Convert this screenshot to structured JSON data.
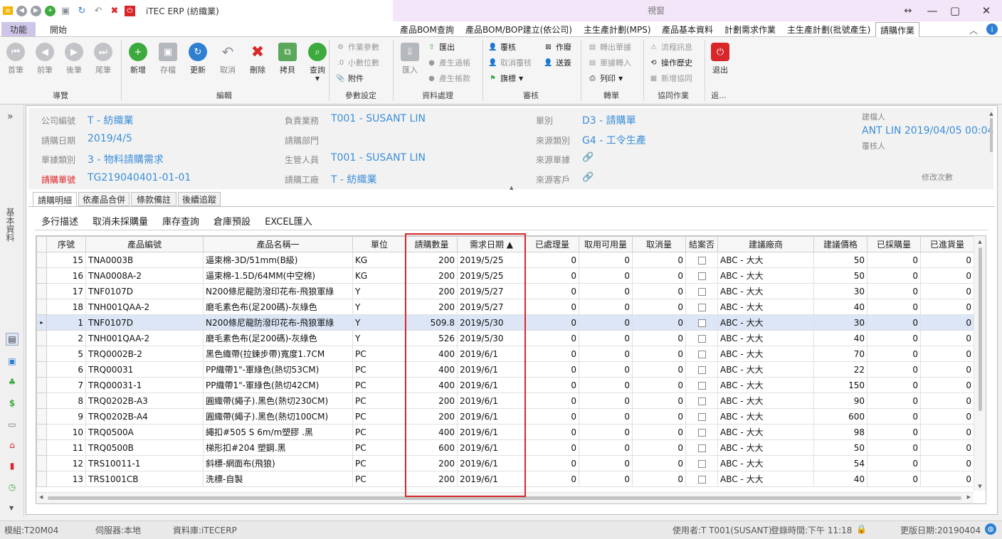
{
  "app": {
    "title": "iTEC ERP (紡織業)",
    "view_title": "視窗"
  },
  "menu": {
    "func_tab": "功能",
    "start_tab": "開始"
  },
  "ctx_tabs": [
    "產品BOM查詢",
    "產品BOM/BOP建立(依公司)",
    "主生產計劃(MPS)",
    "產品基本資料",
    "計劃需求作業",
    "主生產計劃(批號產生)",
    "請購作業"
  ],
  "ribbon": {
    "nav": {
      "first": "首筆",
      "prev": "前筆",
      "next": "後筆",
      "last": "尾筆",
      "group": "導覽"
    },
    "edit": {
      "add": "新增",
      "save": "存檔",
      "update": "更新",
      "cancel": "取消",
      "delete": "刪除",
      "copy": "拷貝",
      "query": "查詢",
      "group": "編輯"
    },
    "params": {
      "op_params": "作業參數",
      "decimals": "小數位數",
      "attach": "附件",
      "group": "參數設定"
    },
    "data": {
      "import": "匯入",
      "export": "匯出",
      "gen_transfer": "產生過帳",
      "gen_account": "產生帳款",
      "group": "資料處理"
    },
    "review": {
      "review": "覆核",
      "cancel_review": "取消覆核",
      "flag": "旗標",
      "void": "作廢",
      "send_sign": "送簽",
      "group": "審核"
    },
    "transfer": {
      "out_doc": "轉出單據",
      "doc_in": "單據轉入",
      "print": "列印",
      "group": "轉單"
    },
    "collab": {
      "flow_msg": "流程訊息",
      "op_history": "操作歷史",
      "add_collab": "新增協同",
      "group": "協同作業"
    },
    "exit": {
      "exit": "退出",
      "group": "返..."
    }
  },
  "left_label": "基本資料",
  "header": {
    "company_label": "公司編號",
    "company": "T - 紡織業",
    "date_label": "請購日期",
    "date": "2019/4/5",
    "doctype_label": "單據類別",
    "doctype": "3 - 物料請購需求",
    "docno_label": "請購單號",
    "docno": "TG219040401-01-01",
    "sales_label": "負責業務",
    "sales": "T001 - SUSANT LIN",
    "dept_label": "請購部門",
    "dept": "",
    "mgr_label": "生管人員",
    "mgr": "T001 - SUSANT LIN",
    "factory_label": "請購工廠",
    "factory": "T - 紡織業",
    "form_label": "單別",
    "form": "D3 - 請購單",
    "src_type_label": "來源類別",
    "src_type": "G4 - 工令生產",
    "src_doc_label": "來源單據",
    "src_cust_label": "來源客戶",
    "creator_label": "建檔人",
    "creator": "ANT LIN 2019/04/05 00:04",
    "reviewer_label": "覆核人",
    "modify_label": "修改次數"
  },
  "form_tabs": [
    "請購明細",
    "依產品合併",
    "條款備註",
    "後續追蹤"
  ],
  "grid_toolbar": [
    "多行描述",
    "取消未採購量",
    "庫存查詢",
    "倉庫預設",
    "EXCEL匯入"
  ],
  "grid": {
    "columns": [
      "序號",
      "產品編號",
      "產品名稱一",
      "單位",
      "請購數量",
      "需求日期 ▲",
      "已處理量",
      "取用可用量",
      "取消量",
      "結案否",
      "建議廠商",
      "建議價格",
      "已採購量",
      "已進貨量"
    ],
    "rows": [
      [
        "15",
        "TNA0003B",
        "逼束棉-3D/51mm(B級)",
        "KG",
        "200",
        "2019/5/25",
        "0",
        "0",
        "0",
        "",
        "ABC - 大大",
        "50",
        "0",
        "0"
      ],
      [
        "16",
        "TNA0008A-2",
        "逼束棉-1.5D/64MM(中空棉)",
        "KG",
        "200",
        "2019/5/25",
        "0",
        "0",
        "0",
        "",
        "ABC - 大大",
        "50",
        "0",
        "0"
      ],
      [
        "17",
        "TNF0107D",
        "N200條尼龍防潑印花布-飛狼軍綠",
        "Y",
        "200",
        "2019/5/27",
        "0",
        "0",
        "0",
        "",
        "ABC - 大大",
        "30",
        "0",
        "0"
      ],
      [
        "18",
        "TNH001QAA-2",
        "磨毛素色布(足200碼)-灰綠色",
        "Y",
        "200",
        "2019/5/27",
        "0",
        "0",
        "0",
        "",
        "ABC - 大大",
        "40",
        "0",
        "0"
      ],
      [
        "1",
        "TNF0107D",
        "N200條尼龍防潑印花布-飛狼軍綠",
        "Y",
        "509.8",
        "2019/5/30",
        "0",
        "0",
        "0",
        "",
        "ABC - 大大",
        "30",
        "0",
        "0"
      ],
      [
        "2",
        "TNH001QAA-2",
        "磨毛素色布(足200碼)-灰綠色",
        "Y",
        "526",
        "2019/5/30",
        "0",
        "0",
        "0",
        "",
        "ABC - 大大",
        "40",
        "0",
        "0"
      ],
      [
        "5",
        "TRQ0002B-2",
        "黑色織帶(拉鍊步帶)寬度1.7CM",
        "PC",
        "400",
        "2019/6/1",
        "0",
        "0",
        "0",
        "",
        "ABC - 大大",
        "70",
        "0",
        "0"
      ],
      [
        "6",
        "TRQ00031",
        "PP織帶1\"-軍綠色(熱切53CM)",
        "PC",
        "400",
        "2019/6/1",
        "0",
        "0",
        "0",
        "",
        "ABC - 大大",
        "22",
        "0",
        "0"
      ],
      [
        "7",
        "TRQ00031-1",
        "PP織帶1\"-軍綠色(熱切42CM)",
        "PC",
        "400",
        "2019/6/1",
        "0",
        "0",
        "0",
        "",
        "ABC - 大大",
        "150",
        "0",
        "0"
      ],
      [
        "8",
        "TRQ0202B-A3",
        "圓織帶(繩子).黑色(熱切230CM)",
        "PC",
        "200",
        "2019/6/1",
        "0",
        "0",
        "0",
        "",
        "ABC - 大大",
        "90",
        "0",
        "0"
      ],
      [
        "9",
        "TRQ0202B-A4",
        "圓織帶(繩子).黑色(熱切100CM)",
        "PC",
        "200",
        "2019/6/1",
        "0",
        "0",
        "0",
        "",
        "ABC - 大大",
        "600",
        "0",
        "0"
      ],
      [
        "10",
        "TRQ0500A",
        "繩扣#505 S 6m/m塑膠 .黑",
        "PC",
        "400",
        "2019/6/1",
        "0",
        "0",
        "0",
        "",
        "ABC - 大大",
        "98",
        "0",
        "0"
      ],
      [
        "11",
        "TRQ0500B",
        "梯形扣#204 塑鋼.黑",
        "PC",
        "600",
        "2019/6/1",
        "0",
        "0",
        "0",
        "",
        "ABC - 大大",
        "50",
        "0",
        "0"
      ],
      [
        "12",
        "TRS10011-1",
        "斜標-網面布(飛狼)",
        "PC",
        "200",
        "2019/6/1",
        "0",
        "0",
        "0",
        "",
        "ABC - 大大",
        "54",
        "0",
        "0"
      ],
      [
        "13",
        "TRS1001CB",
        "洗標-自製",
        "PC",
        "200",
        "2019/6/1",
        "0",
        "0",
        "0",
        "",
        "ABC - 大大",
        "40",
        "0",
        "0"
      ]
    ]
  },
  "status": {
    "module": "模組:T20M04",
    "server": "伺服器:本地",
    "db": "資料庫:iTECERP",
    "user": "使用者:T T001(SUSANT)",
    "login": "登錄時間:下午 11:18",
    "update": "更版日期:20190404"
  }
}
